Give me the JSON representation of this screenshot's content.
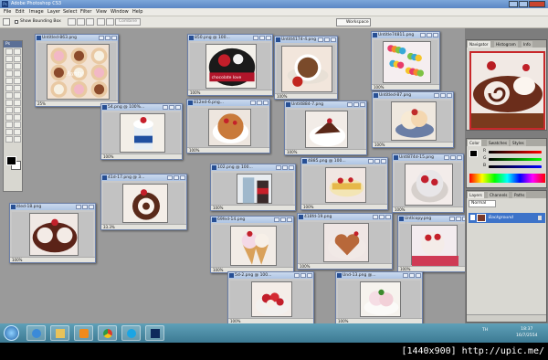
{
  "app": {
    "title": "Adobe Photoshop CS3",
    "ps_logo": "Ps"
  },
  "menu": [
    "File",
    "Edit",
    "Image",
    "Layer",
    "Select",
    "Filter",
    "View",
    "Window",
    "Help"
  ],
  "options": {
    "show_bounding_box": "Show Bounding Box",
    "combine": "Combine",
    "workspace": "Workspace"
  },
  "documents": [
    {
      "title": "Untitled-863.png",
      "zoom": "25%"
    },
    {
      "title": "850.png @ 100...",
      "zoom": "100%"
    },
    {
      "title": "Untitl4174-4.png",
      "zoom": "100%"
    },
    {
      "title": "Untitle74811.png",
      "zoom": "100%"
    },
    {
      "title": "54.png @ 100%...",
      "zoom": "100%"
    },
    {
      "title": "812ed-6.png...",
      "zoom": "100%"
    },
    {
      "title": "Untl4884-7.png",
      "zoom": "100%"
    },
    {
      "title": "Untitled-87.png",
      "zoom": "100%"
    },
    {
      "title": "41d-17.png @ 3...",
      "zoom": "33.3%"
    },
    {
      "title": "102.png @ 100...",
      "zoom": "100%"
    },
    {
      "title": "4885.png @ 100...",
      "zoom": "100%"
    },
    {
      "title": "Untl874d-15.png",
      "zoom": "100%"
    },
    {
      "title": "itled-18.png",
      "zoom": "100%"
    },
    {
      "title": "69fed-14.png",
      "zoom": "100%"
    },
    {
      "title": "418fd-19.png",
      "zoom": "100%"
    },
    {
      "title": "Untlcopy.png",
      "zoom": "100%"
    },
    {
      "title": "5d-2.png @ 100...",
      "zoom": "100%"
    },
    {
      "title": "Und-13.png @...",
      "zoom": "100%"
    }
  ],
  "doc_captions": {
    "chocolate_love": "chocolate love",
    "aunty_script": "Aunty"
  },
  "panels": {
    "navigator_tabs": [
      "Navigator",
      "Histogram",
      "Info"
    ],
    "color_tabs": [
      "Color",
      "Swatches",
      "Styles"
    ],
    "color_channels": [
      "R",
      "G",
      "B"
    ],
    "layers_tabs": [
      "Layers",
      "Channels",
      "Paths"
    ],
    "blend_mode": "Normal",
    "layer_name": "Background"
  },
  "taskbar": {
    "language": "TH",
    "time": "18:37",
    "date": "16/7/2554"
  },
  "watermark": "[1440x900] http://upic.me/",
  "colors": {
    "title_bar": "#5a86c4",
    "layer_selected": "#3d73c9",
    "taskbar": "#3c7a93"
  }
}
